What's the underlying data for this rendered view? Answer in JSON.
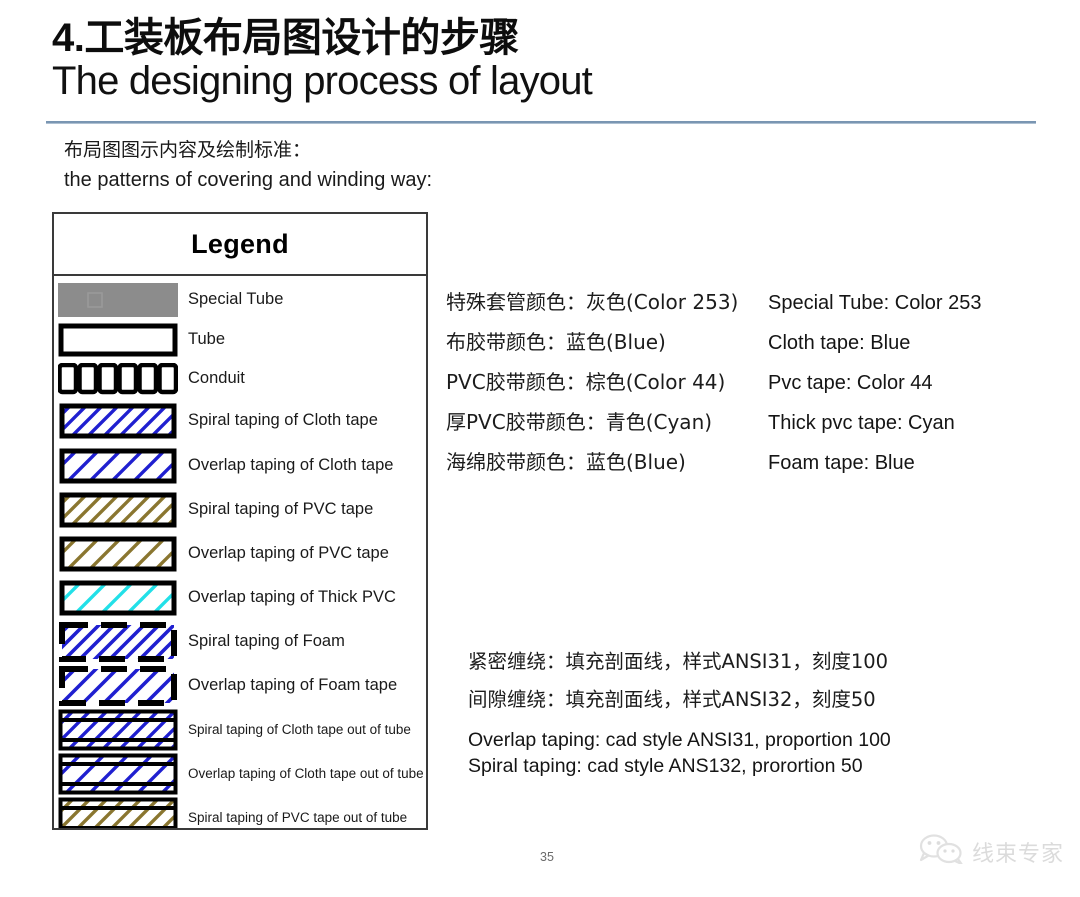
{
  "slide": {
    "title_cn": "4.工装板布局图设计的步骤",
    "title_en": "The designing process of layout",
    "subtitle_cn": "布局图图示内容及绘制标准：",
    "subtitle_en": "the patterns of covering and winding way:",
    "page_number": "35"
  },
  "legend": {
    "header": "Legend",
    "rows": [
      {
        "label": "Special Tube",
        "swatch": "special-tube",
        "size": "normal"
      },
      {
        "label": "Tube",
        "swatch": "tube",
        "size": "normal"
      },
      {
        "label": "Conduit",
        "swatch": "conduit",
        "size": "normal"
      },
      {
        "label": "Spiral taping of Cloth tape",
        "swatch": "spiral-cloth",
        "size": "normal"
      },
      {
        "label": "Overlap taping of Cloth tape",
        "swatch": "overlap-cloth",
        "size": "normal"
      },
      {
        "label": "Spiral taping of PVC tape",
        "swatch": "spiral-pvc",
        "size": "normal"
      },
      {
        "label": "Overlap taping of PVC tape",
        "swatch": "overlap-pvc",
        "size": "normal"
      },
      {
        "label": "Overlap taping of Thick PVC",
        "swatch": "overlap-thick-pvc",
        "size": "normal"
      },
      {
        "label": "Spiral taping of Foam",
        "swatch": "spiral-foam",
        "size": "normal"
      },
      {
        "label": "Overlap taping of Foam tape",
        "swatch": "overlap-foam",
        "size": "normal"
      },
      {
        "label": "Spiral taping of Cloth tape out of tube",
        "swatch": "spiral-cloth-out",
        "size": "small"
      },
      {
        "label": "Overlap taping of Cloth tape out of tube",
        "swatch": "overlap-cloth-out",
        "size": "small"
      },
      {
        "label": "Spiral taping of PVC tape out of tube",
        "swatch": "spiral-pvc-out",
        "size": "small"
      }
    ]
  },
  "color_notes": [
    {
      "cn": "特殊套管颜色：灰色(Color 253)",
      "en": "Special Tube: Color 253"
    },
    {
      "cn": "布胶带颜色：蓝色(Blue)",
      "en": "Cloth tape: Blue"
    },
    {
      "cn": "PVC胶带颜色：棕色(Color 44)",
      "en": "Pvc tape: Color 44"
    },
    {
      "cn": "厚PVC胶带颜色：青色(Cyan)",
      "en": "Thick pvc tape: Cyan"
    },
    {
      "cn": "海绵胶带颜色：蓝色(Blue)",
      "en": "Foam tape: Blue"
    }
  ],
  "process_notes": {
    "cn_line1": "紧密缠绕：填充剖面线，样式ANSI31，刻度100",
    "cn_line2": "间隙缠绕：填充剖面线，样式ANSI32，刻度50",
    "en_line1": "Overlap taping: cad style ANSI31, proportion 100",
    "en_line2": "Spiral taping: cad style ANS132, prorortion 50"
  },
  "watermark": {
    "text": "线束专家"
  },
  "colors": {
    "special_tube_gray": "#8c8c8c",
    "cloth_blue": "#1f1fd0",
    "pvc_brown": "#8a7630",
    "thick_pvc_cyan": "#22e0e8",
    "foam_blue": "#1f1fd0",
    "outline_black": "#000000",
    "title_rule": "#6f8dab"
  }
}
